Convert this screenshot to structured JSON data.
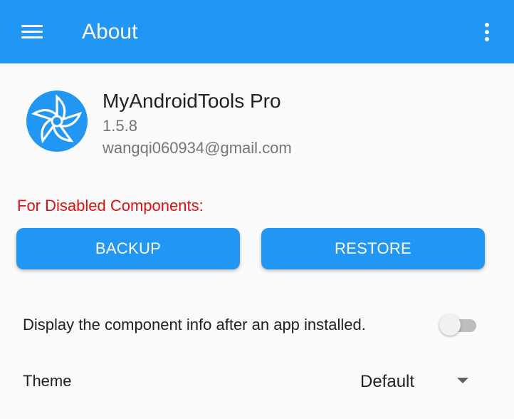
{
  "appbar": {
    "title": "About",
    "menu_icon": "menu-icon",
    "overflow_icon": "more-vert-icon",
    "color": "#2196f3"
  },
  "app_info": {
    "logo_icon": "app-logo-icon",
    "name": "MyAndroidTools Pro",
    "version": "1.5.8",
    "email": "wangqi060934@gmail.com"
  },
  "disabled_components": {
    "label": "For Disabled Components:",
    "label_color": "#e01010",
    "backup_label": "BACKUP",
    "restore_label": "RESTORE"
  },
  "settings": {
    "component_info": {
      "label": "Display the component info after an app installed.",
      "enabled": false
    },
    "theme": {
      "label": "Theme",
      "selected": "Default",
      "icon": "dropdown-arrow-icon"
    }
  }
}
